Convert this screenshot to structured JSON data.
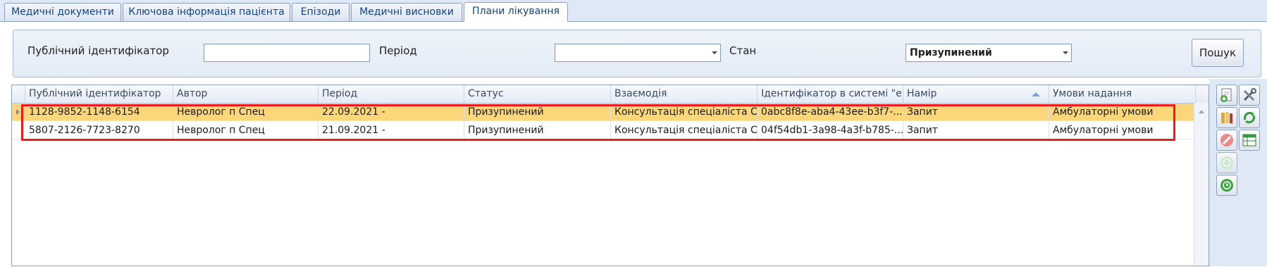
{
  "tabs": [
    {
      "label": "Медичні документи"
    },
    {
      "label": "Ключова інформація пацієнта"
    },
    {
      "label": "Епізоди"
    },
    {
      "label": "Медичні висновки"
    },
    {
      "label": "Плани лікування"
    }
  ],
  "filter": {
    "public_id_label": "Публічний ідентифікатор",
    "public_id_value": "",
    "period_label": "Період",
    "period_value": "",
    "state_label": "Стан",
    "state_value": "Призупинений",
    "search_button": "Пошук"
  },
  "grid": {
    "columns": [
      "Публічний ідентифікатор",
      "Автор",
      "Період",
      "Статус",
      "Взаємодія",
      "Ідентифікатор в системі \"eHe",
      "Намір",
      "Умови надання"
    ],
    "sorted_column": "Намір",
    "rows": [
      {
        "public_id": "1128-9852-1148-6154",
        "author": "Невролог п Спец",
        "period": "22.09.2021 -",
        "status": "Призупинений",
        "interaction": "Консультація спеціаліста С...",
        "ehealth_id": "0abc8f8e-aba4-43ee-b3f7-...",
        "intent": "Запит",
        "conditions": "Амбулаторні умови",
        "selected": true
      },
      {
        "public_id": "5807-2126-7723-8270",
        "author": "Невролог п Спец",
        "period": "21.09.2021 -",
        "status": "Призупинений",
        "interaction": "Консультація спеціаліста С...",
        "ehealth_id": "04f54db1-3a98-4a3f-b785-...",
        "intent": "Запит",
        "conditions": "Амбулаторні умови",
        "selected": false
      }
    ]
  },
  "toolbar_icons": [
    "new-document-icon",
    "tools-icon",
    "books-icon",
    "refresh-icon",
    "cancel-icon",
    "table-icon",
    "clock-disabled-icon",
    "clock-icon"
  ],
  "colors": {
    "selected_row": "#fcd77a",
    "highlight_border": "#ef1b1b",
    "tab_text": "#15428b"
  }
}
